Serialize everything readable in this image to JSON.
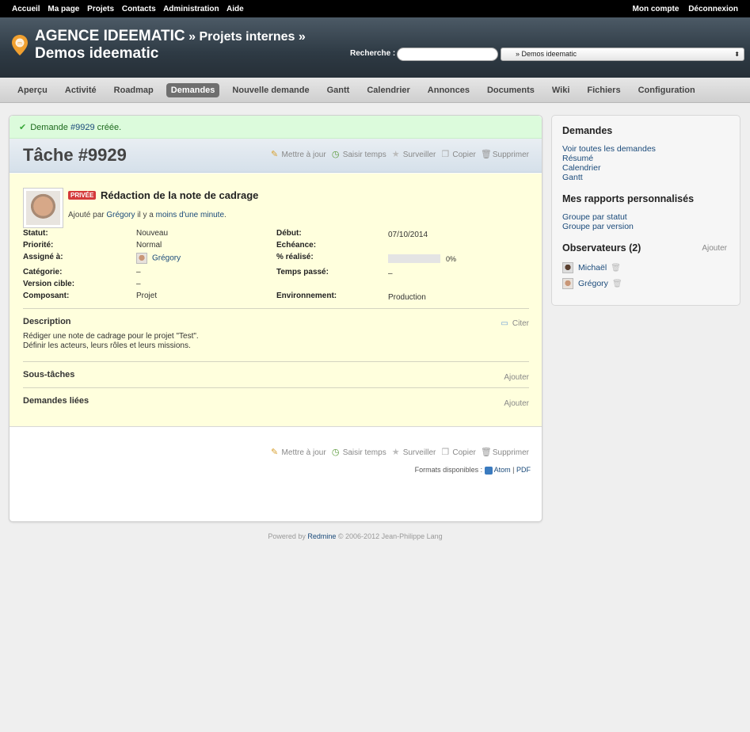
{
  "top_menu": {
    "left": [
      "Accueil",
      "Ma page",
      "Projets",
      "Contacts",
      "Administration",
      "Aide"
    ],
    "right": [
      "Mon compte",
      "Déconnexion"
    ]
  },
  "header": {
    "title_main": "AGENCE IDEEMATIC",
    "title_sep1": " » ",
    "title_mid": "Projets internes",
    "title_sep2": " »",
    "title_last": "Demos ideematic",
    "search_label": "Recherche :",
    "search_value": "",
    "project_select": "» Demos ideematic"
  },
  "main_menu": [
    "Aperçu",
    "Activité",
    "Roadmap",
    "Demandes",
    "Nouvelle demande",
    "Gantt",
    "Calendrier",
    "Annonces",
    "Documents",
    "Wiki",
    "Fichiers",
    "Configuration"
  ],
  "main_menu_selected": "Demandes",
  "flash": {
    "text_before": "Demande ",
    "issue_link": "#9929",
    "text_after": " créée."
  },
  "actions": {
    "update": "Mettre à jour",
    "log_time": "Saisir temps",
    "watch": "Surveiller",
    "copy": "Copier",
    "delete": "Supprimer"
  },
  "issue": {
    "heading": "Tâche #9929",
    "private_badge": "PRIVÉE",
    "subject": "Rédaction de la note de cadrage",
    "added_by_prefix": "Ajouté par ",
    "author": "Grégory",
    "added_mid": " il y a ",
    "age": "moins d'une minute",
    "added_suffix": ".",
    "attributes": {
      "status_label": "Statut:",
      "status": "Nouveau",
      "start_label": "Début:",
      "start": "07/10/2014",
      "priority_label": "Priorité:",
      "priority": "Normal",
      "due_label": "Echéance:",
      "due": "",
      "assigned_label": "Assigné à:",
      "assigned": "Grégory",
      "done_label": "% réalisé:",
      "done": "0%",
      "done_ratio": 0,
      "category_label": "Catégorie:",
      "category": "–",
      "spent_label": "Temps passé:",
      "spent": "–",
      "version_label": "Version cible:",
      "version": "–",
      "component_label": "Composant:",
      "component": "Projet",
      "environment_label": "Environnement:",
      "environment": "Production"
    },
    "description_title": "Description",
    "quote": "Citer",
    "description_line1": "Rédiger une note de cadrage pour le projet \"Test\".",
    "description_line2": "Définir les acteurs, leurs rôles et leurs missions.",
    "subtasks_title": "Sous-tâches",
    "relations_title": "Demandes liées",
    "add": "Ajouter"
  },
  "formats": {
    "label": "Formats disponibles : ",
    "atom": "Atom",
    "sep": " | ",
    "pdf": "PDF"
  },
  "sidebar": {
    "issues_title": "Demandes",
    "issues_links": [
      "Voir toutes les demandes",
      "Résumé",
      "Calendrier",
      "Gantt"
    ],
    "reports_title": "Mes rapports personnalisés",
    "reports_links": [
      "Groupe par statut",
      "Groupe par version"
    ],
    "watchers_title": "Observateurs (2)",
    "watchers_add": "Ajouter",
    "watchers": [
      "Michaël",
      "Grégory"
    ]
  },
  "footer": {
    "prefix": "Powered by ",
    "link": "Redmine",
    "suffix": " © 2006-2012 Jean-Philippe Lang"
  },
  "colors": {
    "accent": "#1a4a7a",
    "flash_bg": "#dcfbdc",
    "issue_bg": "#ffffdd",
    "private": "#d43a3a",
    "logo": "#f0a030"
  }
}
